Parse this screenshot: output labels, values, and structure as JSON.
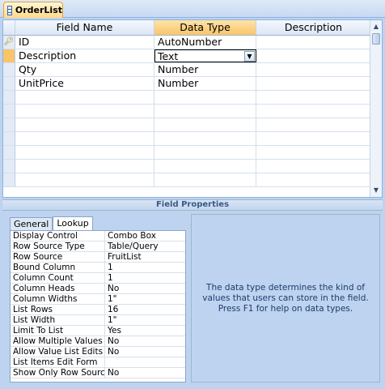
{
  "tab": {
    "title": "OrderList",
    "icon": "table-icon"
  },
  "grid": {
    "headers": {
      "field_name": "Field Name",
      "data_type": "Data Type",
      "description": "Description"
    },
    "rows": [
      {
        "field_name": "ID",
        "data_type": "AutoNumber",
        "description": "",
        "primary_key": true
      },
      {
        "field_name": "Description",
        "data_type": "Text",
        "description": "",
        "active": true
      },
      {
        "field_name": "Qty",
        "data_type": "Number",
        "description": ""
      },
      {
        "field_name": "UnitPrice",
        "data_type": "Number",
        "description": ""
      }
    ]
  },
  "field_properties": {
    "title": "Field Properties",
    "tabs": [
      "General",
      "Lookup"
    ],
    "active_tab": "Lookup",
    "properties": [
      {
        "name": "Display Control",
        "value": "Combo Box"
      },
      {
        "name": "Row Source Type",
        "value": "Table/Query"
      },
      {
        "name": "Row Source",
        "value": "FruitList"
      },
      {
        "name": "Bound Column",
        "value": "1"
      },
      {
        "name": "Column Count",
        "value": "1"
      },
      {
        "name": "Column Heads",
        "value": "No"
      },
      {
        "name": "Column Widths",
        "value": "1\""
      },
      {
        "name": "List Rows",
        "value": "16"
      },
      {
        "name": "List Width",
        "value": "1\""
      },
      {
        "name": "Limit To List",
        "value": "Yes"
      },
      {
        "name": "Allow Multiple Values",
        "value": "No"
      },
      {
        "name": "Allow Value List Edits",
        "value": "No"
      },
      {
        "name": "List Items Edit Form",
        "value": ""
      },
      {
        "name": "Show Only Row Source Values",
        "value": "No"
      }
    ],
    "help_text": "The data type determines the kind of values that users can store in the field.  Press F1 for help on data types."
  }
}
